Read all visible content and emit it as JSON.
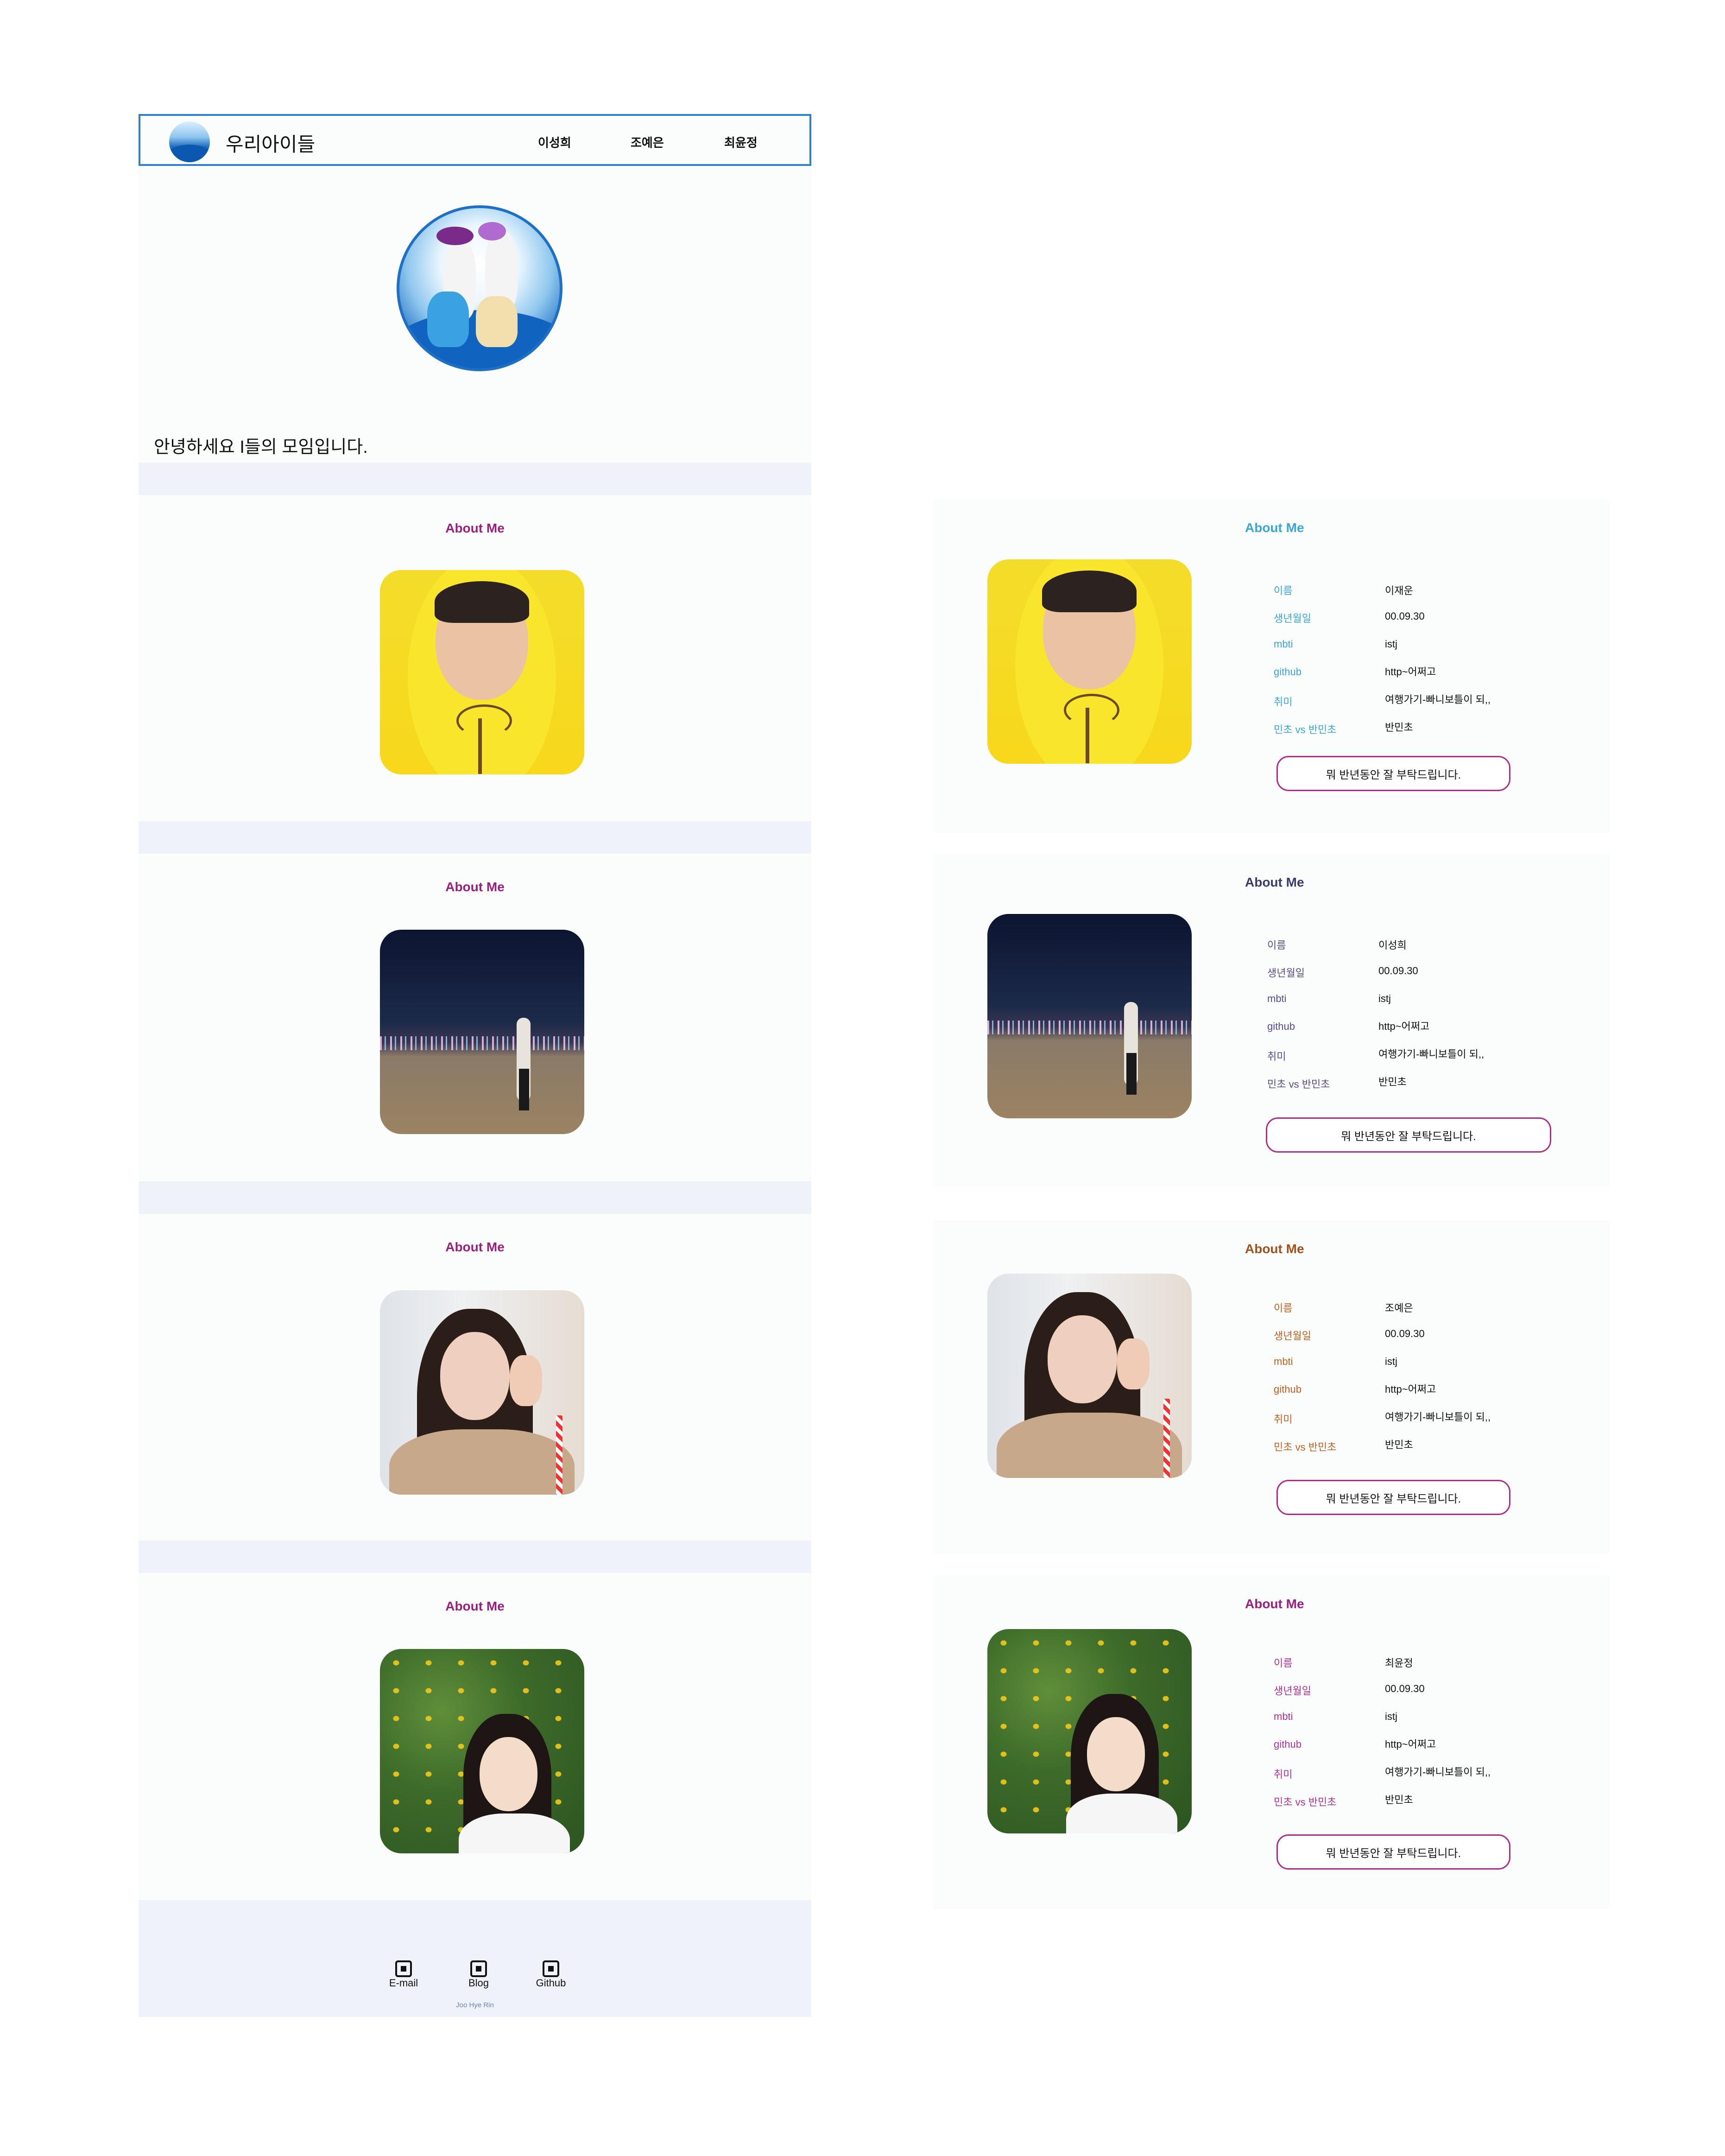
{
  "brand": "우리아이들",
  "nav": [
    "이성희",
    "조예은",
    "최윤정"
  ],
  "hero_text": "안녕하세요 I들의 모임입니다.",
  "about_title": "About Me",
  "footer": {
    "links": [
      "E-mail",
      "Blog",
      "Github"
    ],
    "name": "Joo Hye Rin"
  },
  "profile_labels": {
    "name": "이름",
    "birthday": "생년월일",
    "mbti": "mbti",
    "github": "github",
    "hobby": "취미",
    "mincho": "민초 vs 반민초"
  },
  "profiles": [
    {
      "title_color": "#3aa6d6",
      "label_color": "#3aa6d6",
      "name": "이재운",
      "birthday": "00.09.30",
      "mbti": "istj",
      "github": "http~어쩌고",
      "hobby": "여행가기-빠니보틀이 되,,",
      "mincho": "반민초",
      "button": "뭐 반년동안 잘 부탁드립니다."
    },
    {
      "title_color": "#3b3a6e",
      "label_color": "#5a4a8a",
      "name": "이성희",
      "birthday": "00.09.30",
      "mbti": "istj",
      "github": "http~어쩌고",
      "hobby": "여행가기-빠니보틀이 되,,",
      "mincho": "반민초",
      "button": "뭐 반년동안 잘 부탁드립니다."
    },
    {
      "title_color": "#a0521a",
      "label_color": "#c0601e",
      "name": "조예은",
      "birthday": "00.09.30",
      "mbti": "istj",
      "github": "http~어쩌고",
      "hobby": "여행가기-빠니보틀이 되,,",
      "mincho": "반민초",
      "button": "뭐 반년동안 잘 부탁드립니다."
    },
    {
      "title_color": "#9a2080",
      "label_color": "#b0309a",
      "name": "최윤정",
      "birthday": "00.09.30",
      "mbti": "istj",
      "github": "http~어쩌고",
      "hobby": "여행가기-빠니보틀이 되,,",
      "mincho": "반민초",
      "button": "뭐 반년동안 잘 부탁드립니다."
    }
  ]
}
